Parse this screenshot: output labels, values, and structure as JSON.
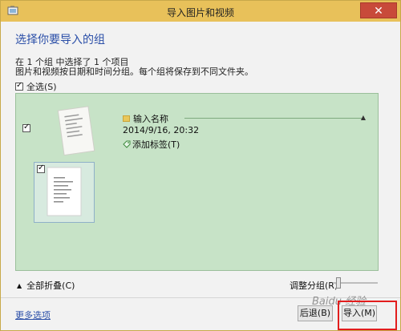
{
  "window": {
    "title": "导入图片和视频",
    "close_glyph": "✕"
  },
  "heading": "选择你要导入的组",
  "summary": "在 1 个组 中选择了 1 个项目",
  "description": "图片和视频按日期和时间分组。每个组将保存到不同文件夹。",
  "select_all": {
    "label": "全选(S)",
    "checked": true
  },
  "group": {
    "checked": true,
    "name": "输入名称",
    "date": "2014/9/16, 20:32",
    "add_tag": "添加标签(T)",
    "items": [
      {
        "checked": true
      }
    ]
  },
  "footer": {
    "collapse_all": "全部折叠(C)",
    "adjust_group": "调整分组(R):",
    "more_options": "更多选项",
    "back_button": "后退(B)",
    "import_button": "导入(M)"
  },
  "colors": {
    "title_bar": "#e8c15a",
    "group_background": "#c7e3c7",
    "accent_text": "#2b4fa8",
    "close_button": "#c84a3a",
    "highlight_box": "#e21d1d"
  }
}
